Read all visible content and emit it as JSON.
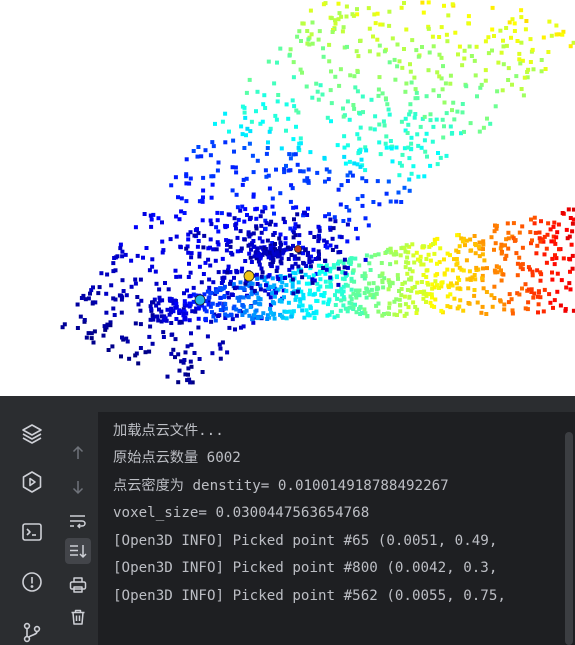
{
  "viewer": {
    "background": "#ffffff",
    "picked_markers": [
      {
        "id": "65",
        "color": "#1fb5e8"
      },
      {
        "id": "800",
        "color": "#f0c419"
      },
      {
        "id": "562",
        "color": "#c0401a"
      }
    ]
  },
  "activity_bar": {
    "icons": [
      "layers-icon",
      "python-packages-icon",
      "terminal-icon",
      "problems-icon",
      "git-icon"
    ]
  },
  "tool_strip": {
    "icons": [
      "scroll-up-icon",
      "scroll-down-icon",
      "soft-wrap-icon",
      "scroll-to-end-icon",
      "print-icon",
      "clear-icon"
    ]
  },
  "console": {
    "lines": [
      "加载点云文件...",
      "原始点云数量 6002",
      "点云密度为 denstity= 0.010014918788492267",
      "voxel_size= 0.0300447563654768",
      "[Open3D INFO] Picked point #65 (0.0051, 0.49,",
      "[Open3D INFO] Picked point #800 (0.0042, 0.3,",
      "[Open3D INFO] Picked point #562 (0.0055, 0.75,"
    ]
  },
  "colors": {
    "console_bg": "#1e1f22",
    "panel_bg": "#2b2d30",
    "console_text": "#bcbec4",
    "icon": "#ced0d6"
  }
}
